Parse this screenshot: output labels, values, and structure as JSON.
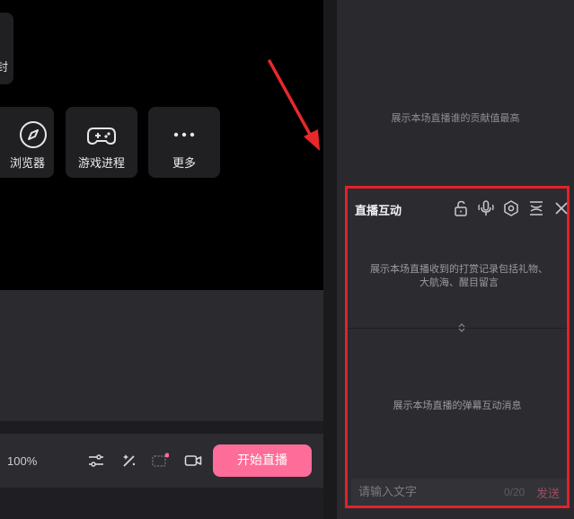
{
  "scene_tiles": {
    "partial_glyph": "封",
    "browser_label": "浏览器",
    "game_label": "游戏进程",
    "more_label": "更多"
  },
  "toolbar": {
    "zoom": "100%",
    "start_live_label": "开始直播",
    "icons": [
      "adjust-sliders-icon",
      "magic-wand-icon",
      "interaction-icon",
      "camera-icon"
    ]
  },
  "contribution": {
    "hint": "展示本场直播谁的贡献值最高"
  },
  "live_interaction": {
    "title": "直播互动",
    "gift_hint": "展示本场直播收到的打赏记录包括礼物、大航海、醒目留言",
    "danmu_hint": "展示本场直播的弹幕互动消息",
    "input_placeholder": "请输入文字",
    "counter": "0/20",
    "send_label": "发送",
    "accent_color": "#fe6d99",
    "highlight_color": "#e3212a"
  }
}
